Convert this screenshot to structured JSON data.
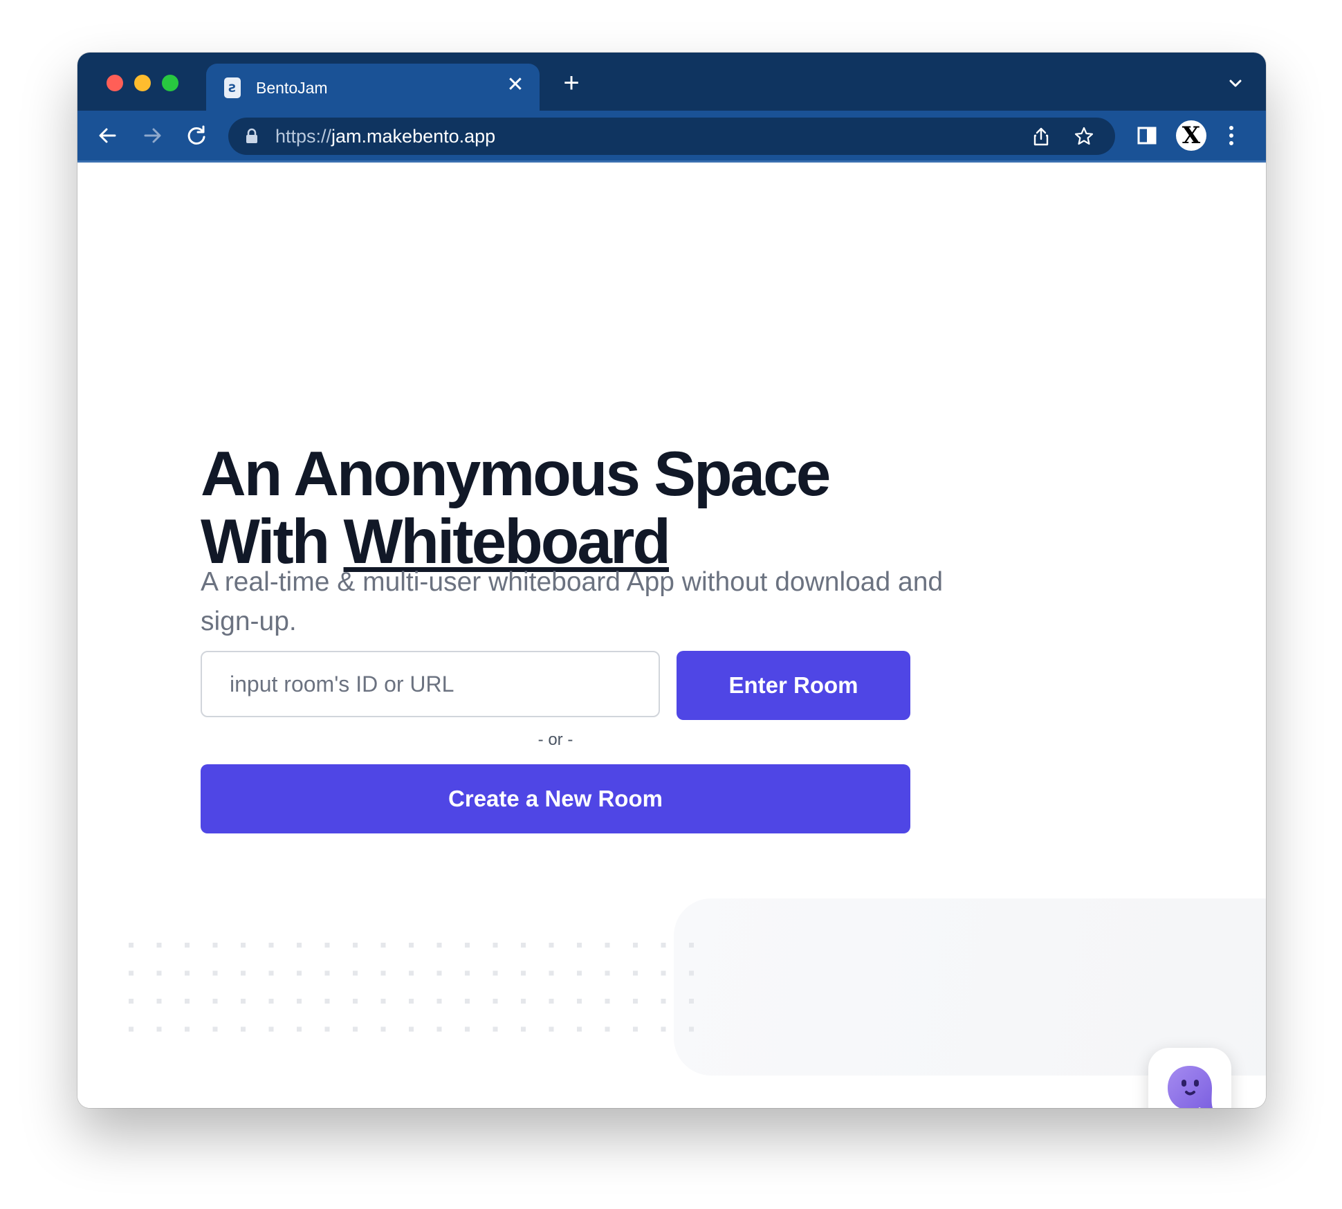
{
  "browser": {
    "tab": {
      "title": "BentoJam",
      "favicon_glyph": "Ƨ",
      "close_label": "✕"
    },
    "new_tab_label": "+",
    "url": {
      "scheme": "https://",
      "host": "jam.makebento.app"
    },
    "profile_initial": "X"
  },
  "hero": {
    "title_line1": "An Anonymous Space",
    "title_line2_prefix": "With ",
    "title_line2_emphasis": "Whiteboard",
    "subtitle": "A real-time & multi-user whiteboard App without download and sign-up."
  },
  "room_form": {
    "input_placeholder": "input room's ID or URL",
    "enter_button": "Enter Room",
    "or_separator": "- or -",
    "create_button": "Create a New Room"
  },
  "colors": {
    "brand": "#4f46e5",
    "browser_chrome": "#1a5296",
    "tabstrip": "#0f3460",
    "heading": "#111827",
    "muted_text": "#6b7280"
  },
  "icons": {
    "tab_favicon": "bentojam-favicon-icon",
    "back": "arrow-left-icon",
    "forward": "arrow-right-icon",
    "reload": "reload-icon",
    "lock": "lock-icon",
    "share": "share-icon",
    "bookmark": "star-icon",
    "side_panel": "side-panel-icon",
    "menu": "kebab-menu-icon",
    "tab_list": "chevron-down-icon",
    "chat": "chat-bubble-face-icon"
  }
}
